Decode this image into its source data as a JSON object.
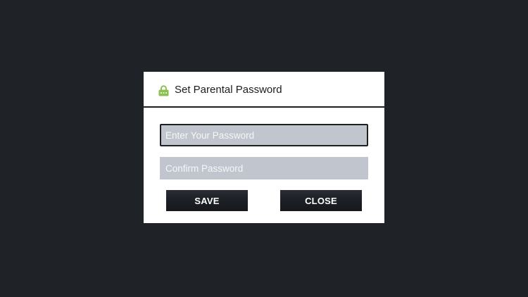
{
  "dialog": {
    "title": "Set Parental Password",
    "icon": "lock-icon",
    "password_field": {
      "value": "",
      "placeholder": "Enter Your Password"
    },
    "confirm_field": {
      "value": "",
      "placeholder": "Confirm Password"
    },
    "save_label": "SAVE",
    "close_label": "CLOSE"
  },
  "colors": {
    "backdrop": "#1f2226",
    "dialog_background": "#ffffff",
    "field_background": "#c1c6ce",
    "button_background": "#1c1f24",
    "lock_icon": "#8cc152"
  }
}
